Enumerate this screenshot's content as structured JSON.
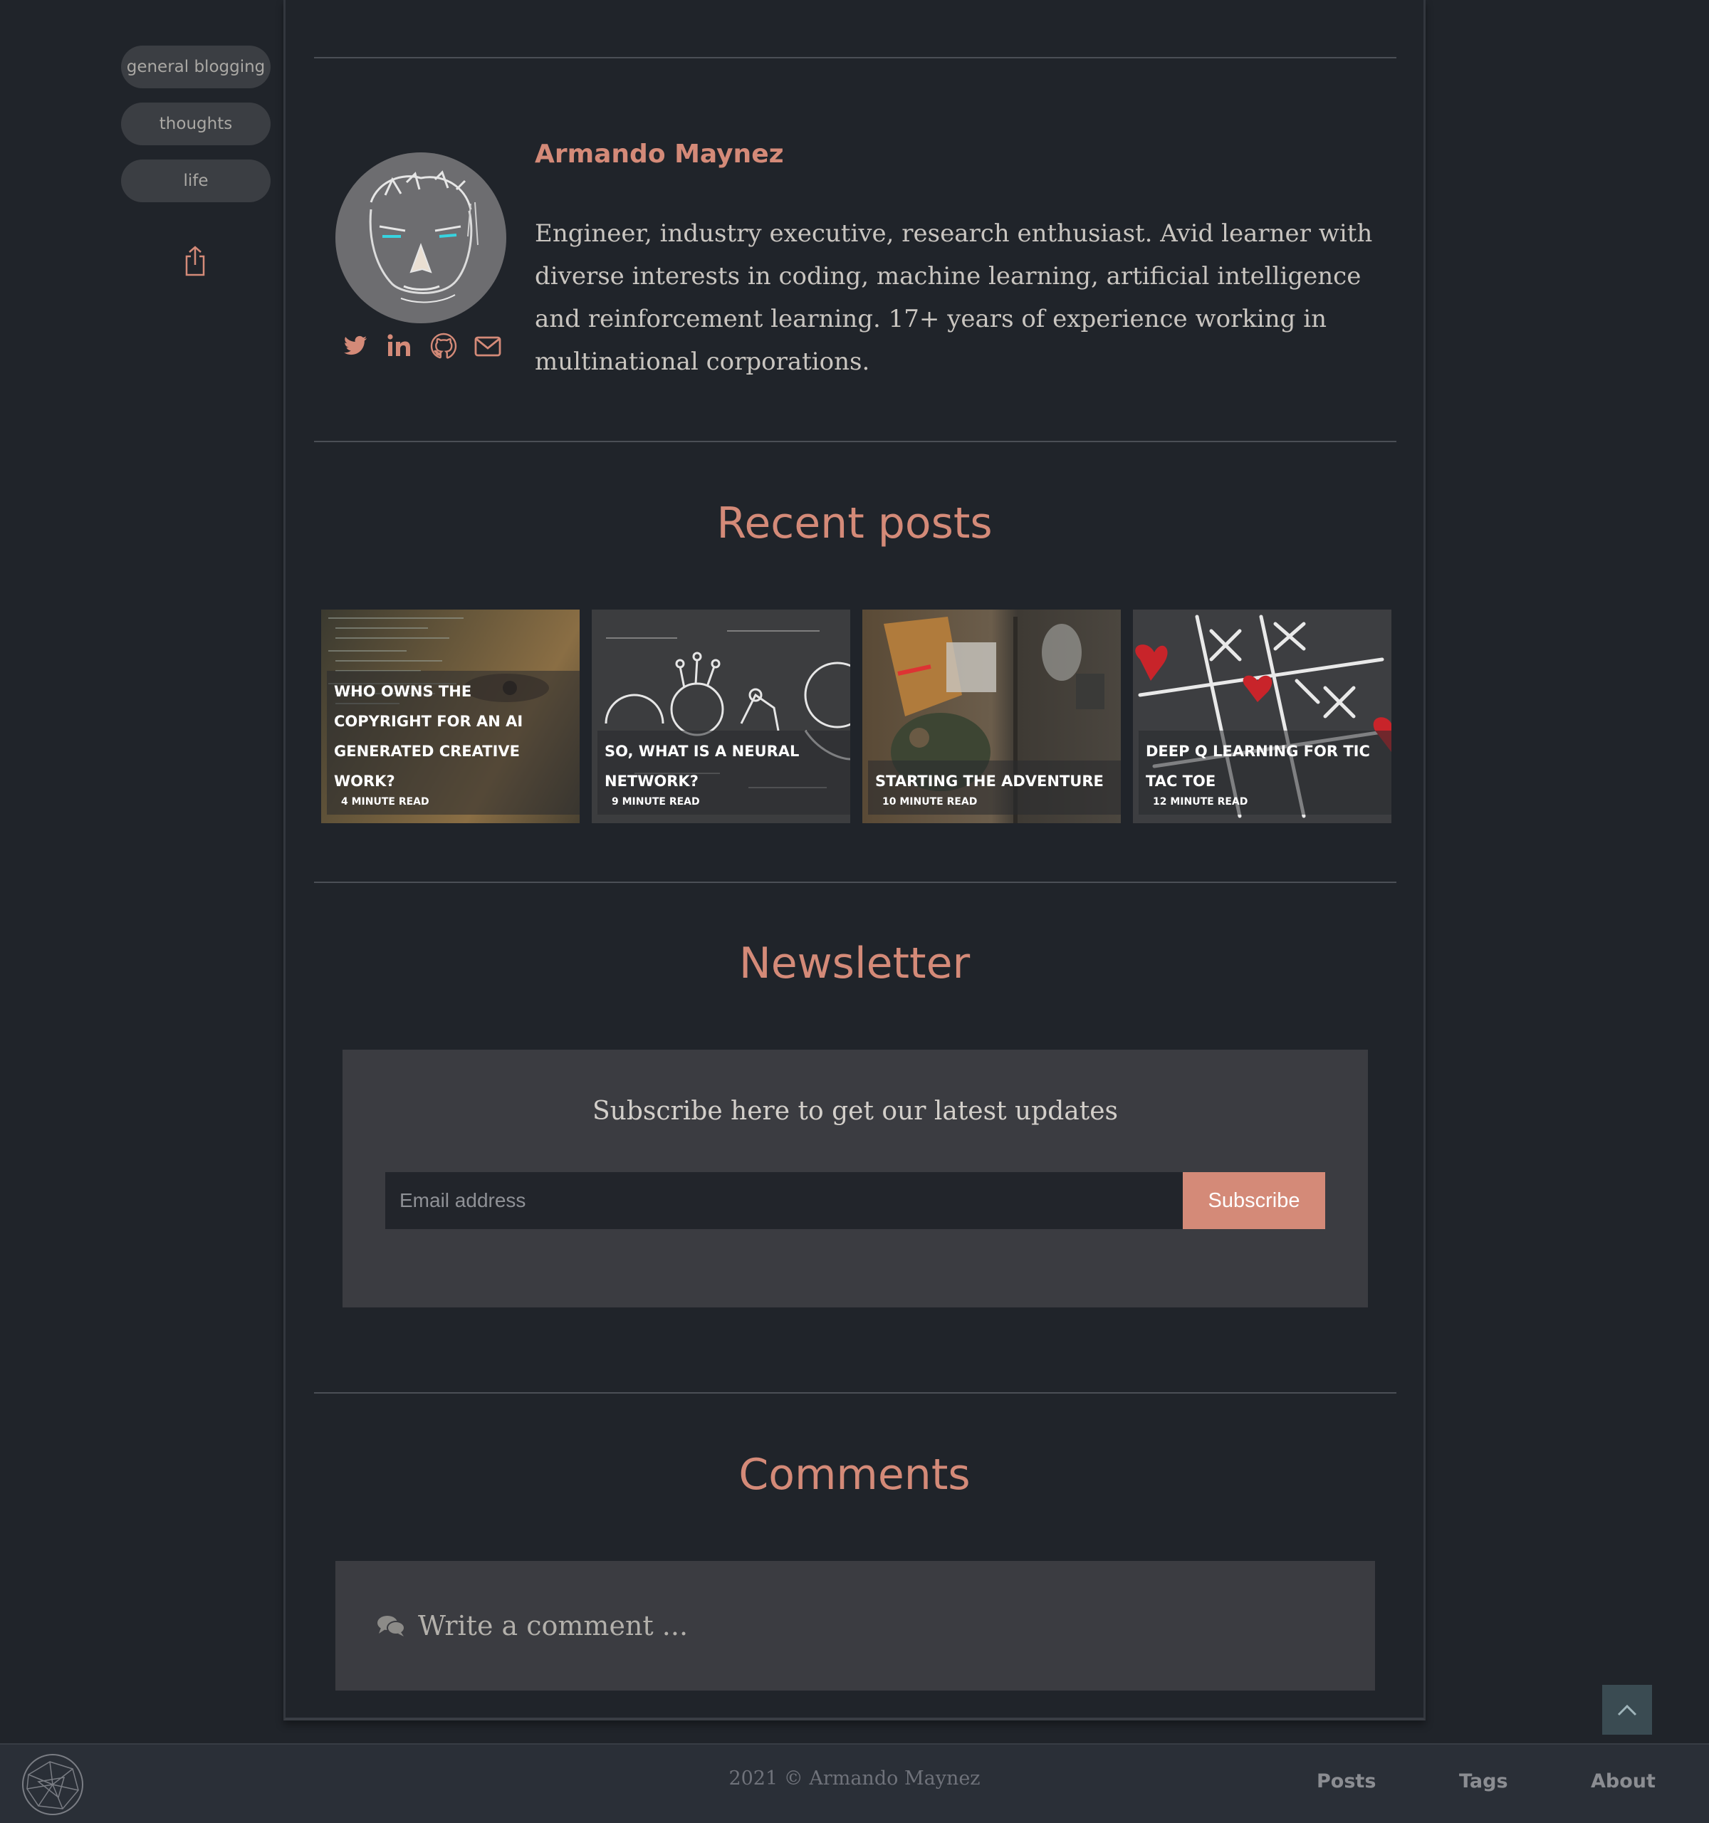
{
  "sidebar": {
    "tags": [
      "general blogging",
      "thoughts",
      "life"
    ],
    "share_icon": "share-icon"
  },
  "author": {
    "name": "Armando Maynez",
    "bio": "Engineer, industry executive, research enthusiast. Avid learner with diverse interests in coding, machine learning, artificial intelligence and reinforcement learning. 17+ years of experience working in multinational corporations.",
    "socials": [
      "twitter-icon",
      "linkedin-icon",
      "github-icon",
      "email-icon"
    ]
  },
  "recent": {
    "title": "Recent posts",
    "posts": [
      {
        "title": "Who owns the copyright for an AI generated creative work?",
        "read": "4 minute read"
      },
      {
        "title": "So, what is a Neural Network?",
        "read": "9 minute read"
      },
      {
        "title": "Starting the adventure",
        "read": "10 minute read"
      },
      {
        "title": "Deep Q Learning for Tic Tac Toe",
        "read": "12 minute read"
      }
    ]
  },
  "newsletter": {
    "title": "Newsletter",
    "text": "Subscribe here to get our latest updates",
    "placeholder": "Email address",
    "button": "Subscribe"
  },
  "comments": {
    "title": "Comments",
    "placeholder": "Write a comment ..."
  },
  "footer": {
    "copyright": "2021 © Armando Maynez",
    "nav": [
      "Posts",
      "Tags",
      "About"
    ]
  },
  "colors": {
    "accent": "#d48a78",
    "background": "#20242a",
    "panel": "#3b3c41"
  }
}
